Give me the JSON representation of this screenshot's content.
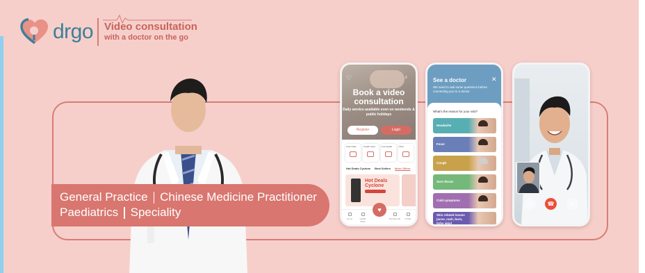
{
  "brand": {
    "logo_text": "drgo",
    "tagline_line1": "Video consultation",
    "tagline_line2": "with a doctor on the go",
    "logo_icon": "heart-stethoscope-icon"
  },
  "colors": {
    "background": "#f6cfcb",
    "accent": "#d8766f",
    "brand_blue": "#3e7f99"
  },
  "specialties": {
    "line1": [
      "General Practice",
      "Chinese Medicine Practitioner"
    ],
    "line2": [
      "Paediatrics",
      "Speciality"
    ]
  },
  "phone_home": {
    "hero_title": "Book a video consultation",
    "hero_subtitle": "Daily service available even on weekends & public holidays",
    "register_label": "Register",
    "login_label": "Login",
    "tiles": [
      "Chat Vitals",
      "Health Index",
      "Your Health",
      "Clinic"
    ],
    "tabs": [
      "Hot Deals Cyclone",
      "Best Sellers",
      "More Offers"
    ],
    "promo_title": "Hot Deals Cyclone",
    "nav": [
      "Home",
      "Health Book",
      "Consult",
      "My Records",
      "Profile"
    ]
  },
  "phone_questions": {
    "title": "See a doctor",
    "subtitle": "We need to ask some questions before connecting you to a doctor",
    "question": "What's the reason for your visit?",
    "options": [
      "Headache",
      "Fever",
      "Cough",
      "Sore throat",
      "Cold symptoms",
      "Skin related issues (acne, rash, burn, itchy skin)"
    ]
  },
  "phone_call": {
    "controls": [
      "mute-icon",
      "end-call-icon",
      "camera-switch-icon"
    ]
  }
}
